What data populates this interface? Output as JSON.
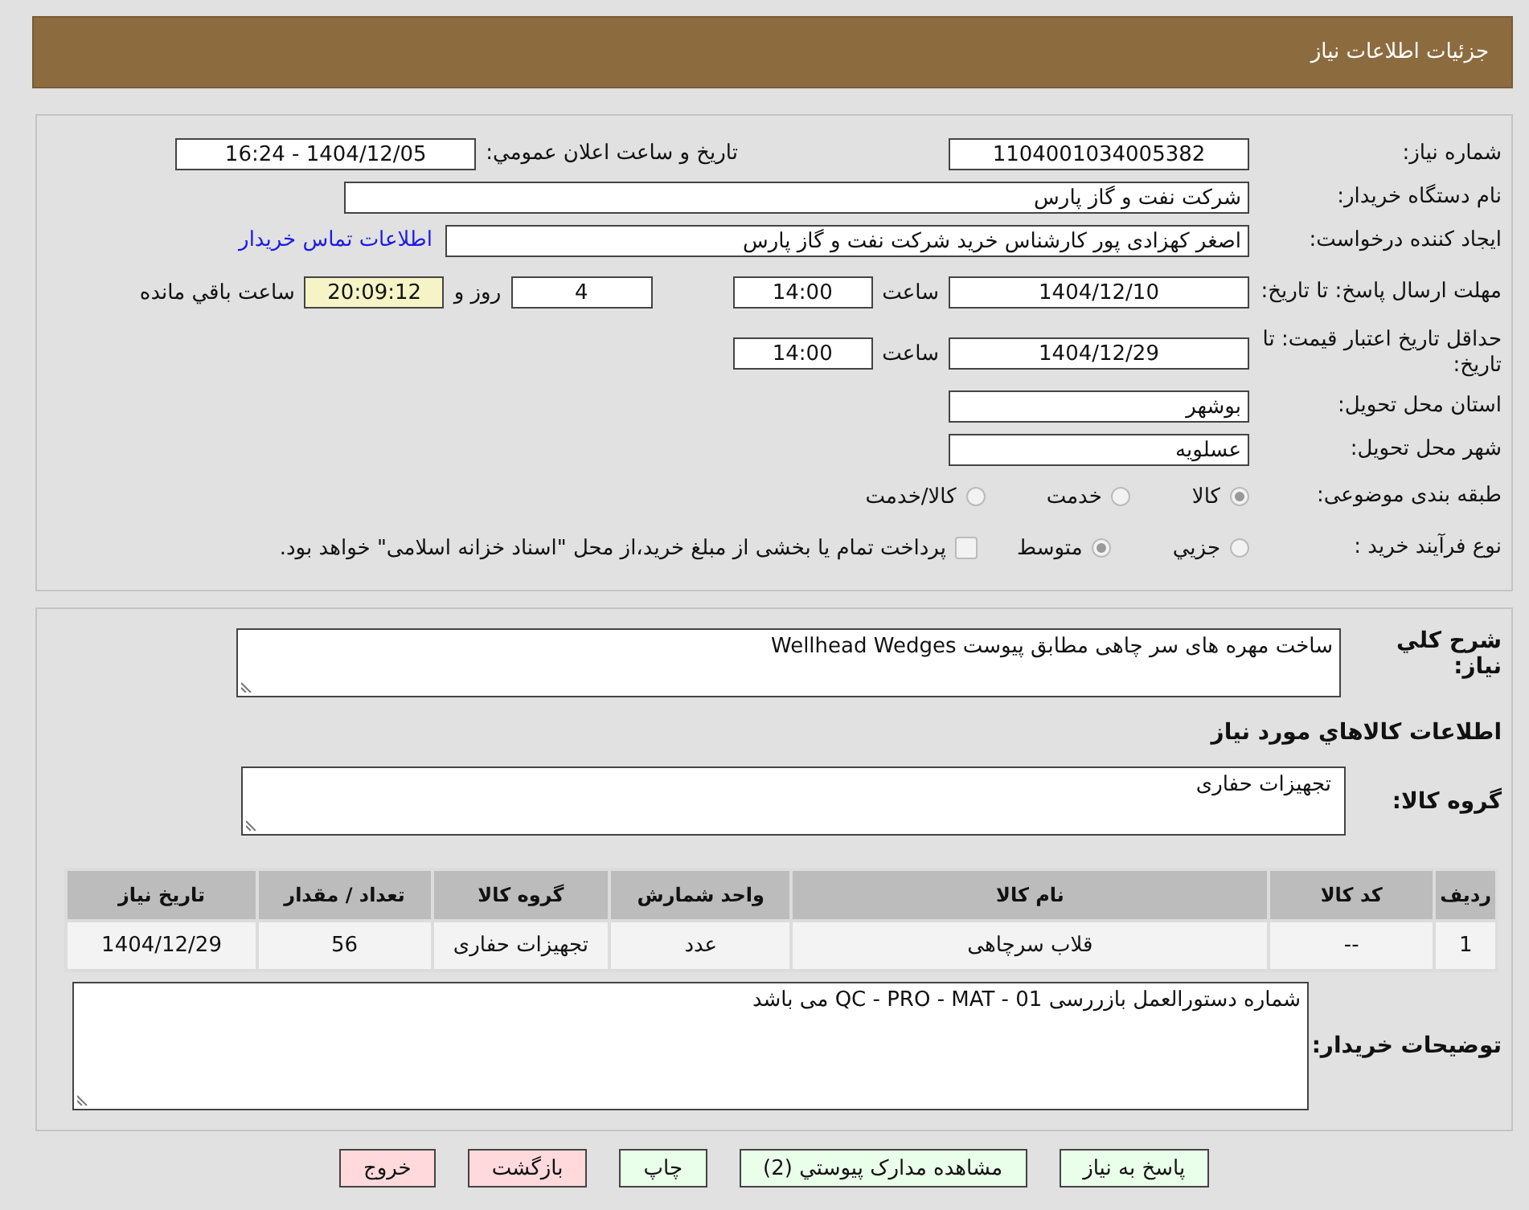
{
  "header": {
    "title": "جزئیات اطلاعات نیاز"
  },
  "need_number": {
    "label": "شماره نیاز:",
    "value": "1104001034005382"
  },
  "announce": {
    "label": "تاریخ و ساعت اعلان عمومي:",
    "value": "1404/12/05 - 16:24"
  },
  "buyer": {
    "label": "نام دستگاه خریدار:",
    "value": "شرکت نفت و گاز پارس"
  },
  "creator": {
    "label": "ایجاد کننده درخواست:",
    "value": "اصغر کهزادی پور کارشناس خرید شرکت نفت و گاز پارس",
    "link": "اطلاعات تماس خریدار"
  },
  "reply_deadline": {
    "label": "مهلت ارسال پاسخ: تا تاریخ:",
    "date": "1404/12/10",
    "time_label": "ساعت",
    "time": "14:00",
    "days": "4",
    "days_label": "روز و",
    "remaining": "20:09:12",
    "remaining_label": "ساعت باقي مانده"
  },
  "validity": {
    "label": "حداقل تاریخ اعتبار قیمت: تا تاریخ:",
    "date": "1404/12/29",
    "time_label": "ساعت",
    "time": "14:00"
  },
  "province": {
    "label": "استان محل تحویل:",
    "value": "بوشهر"
  },
  "city": {
    "label": "شهر محل تحویل:",
    "value": "عسلویه"
  },
  "category": {
    "label": "طبقه بندی موضوعی:",
    "options": [
      {
        "label": "کالا",
        "selected": true
      },
      {
        "label": "خدمت",
        "selected": false
      },
      {
        "label": "کالا/خدمت",
        "selected": false
      }
    ]
  },
  "process": {
    "label": "نوع فرآیند خرید :",
    "options": [
      {
        "label": "جزيي",
        "selected": false
      },
      {
        "label": "متوسط",
        "selected": true
      }
    ],
    "payment": {
      "label": "پرداخت تمام یا بخشی از مبلغ خرید،از محل \"اسناد خزانه اسلامی\" خواهد بود.",
      "checked": false
    }
  },
  "description": {
    "label": "شرح کلي نياز:",
    "value": "ساخت مهره های سر چاهی مطابق پیوست Wellhead Wedges"
  },
  "goods_heading": "اطلاعات کالاهاي مورد نياز",
  "goods_group": {
    "label": "گروه کالا:",
    "value": "تجهیزات حفاری"
  },
  "table": {
    "columns": [
      "ردیف",
      "کد کالا",
      "نام کالا",
      "واحد شمارش",
      "گروه کالا",
      "تعداد / مقدار",
      "تاریخ نیاز"
    ],
    "rows": [
      [
        "1",
        "--",
        "قلاب سرچاهی",
        "عدد",
        "تجهیزات حفاری",
        "56",
        "1404/12/29"
      ]
    ]
  },
  "buyer_notes": {
    "label": "توضیحات خریدار:",
    "value": "شماره دستورالعمل بازررسی QC - PRO - MAT - 01 می باشد"
  },
  "buttons": [
    {
      "label": "پاسخ به نیاز",
      "kind": "normal"
    },
    {
      "label": "مشاهده مدارک پیوستي (2)",
      "kind": "normal"
    },
    {
      "label": "چاپ",
      "kind": "normal"
    },
    {
      "label": "بازگشت",
      "kind": "danger"
    },
    {
      "label": "خروج",
      "kind": "danger"
    }
  ]
}
